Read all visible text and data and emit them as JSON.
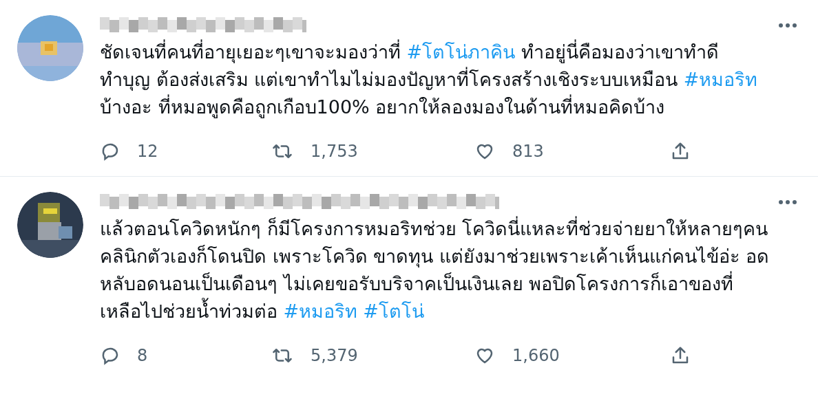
{
  "tweets": [
    {
      "avatar": {
        "kind": "picture"
      },
      "body_lines": [
        [
          {
            "kind": "text",
            "text": "ชัดเจนที่คนที่อายุเยอะๆเขาจะมองว่าที่ "
          },
          {
            "kind": "hashtag",
            "text": "#โตโน่ภาคิน"
          },
          {
            "kind": "text",
            "text": " ทำอยู่นี่คือมองว่าเขาทำดี"
          }
        ],
        [
          {
            "kind": "text",
            "text": "ทำบุญ ต้องส่งเสริม แต่เขาทำไมไม่มองปัญหาที่โครงสร้างเชิงระบบเหมือน "
          },
          {
            "kind": "hashtag",
            "text": "#หมอริท"
          }
        ],
        [
          {
            "kind": "text",
            "text": "บ้างอะ ที่หมอพูดคือถูกเกือบ100% อยากให้ลองมองในด้านที่หมอคิดบ้าง"
          }
        ]
      ],
      "actions": {
        "replies": "12",
        "retweets": "1,753",
        "likes": "813"
      }
    },
    {
      "avatar": {
        "kind": "picture"
      },
      "body_lines": [
        [
          {
            "kind": "text",
            "text": "แล้วตอนโควิดหนักๆ ก็มีโครงการหมอริทช่วย โควิดนี่แหละที่ช่วยจ่ายยาให้หลายๆคน"
          }
        ],
        [
          {
            "kind": "text",
            "text": "คลินิกตัวเองก็โดนปิด เพราะโควิด ขาดทุน แต่ยังมาช่วยเพราะเค้าเห็นแก่คนไข้อ่ะ อด"
          }
        ],
        [
          {
            "kind": "text",
            "text": "หลับอดนอนเป็นเดือนๆ ไม่เคยขอรับบริจาคเป็นเงินเลย พอปิดโครงการก็เอาของที่"
          }
        ],
        [
          {
            "kind": "text",
            "text": "เหลือไปช่วยน้ำท่วมต่อ "
          },
          {
            "kind": "hashtag",
            "text": "#หมอริท"
          },
          {
            "kind": "hashtag",
            "text": "#โตโน่"
          }
        ]
      ],
      "actions": {
        "replies": "8",
        "retweets": "5,379",
        "likes": "1,660"
      }
    }
  ]
}
